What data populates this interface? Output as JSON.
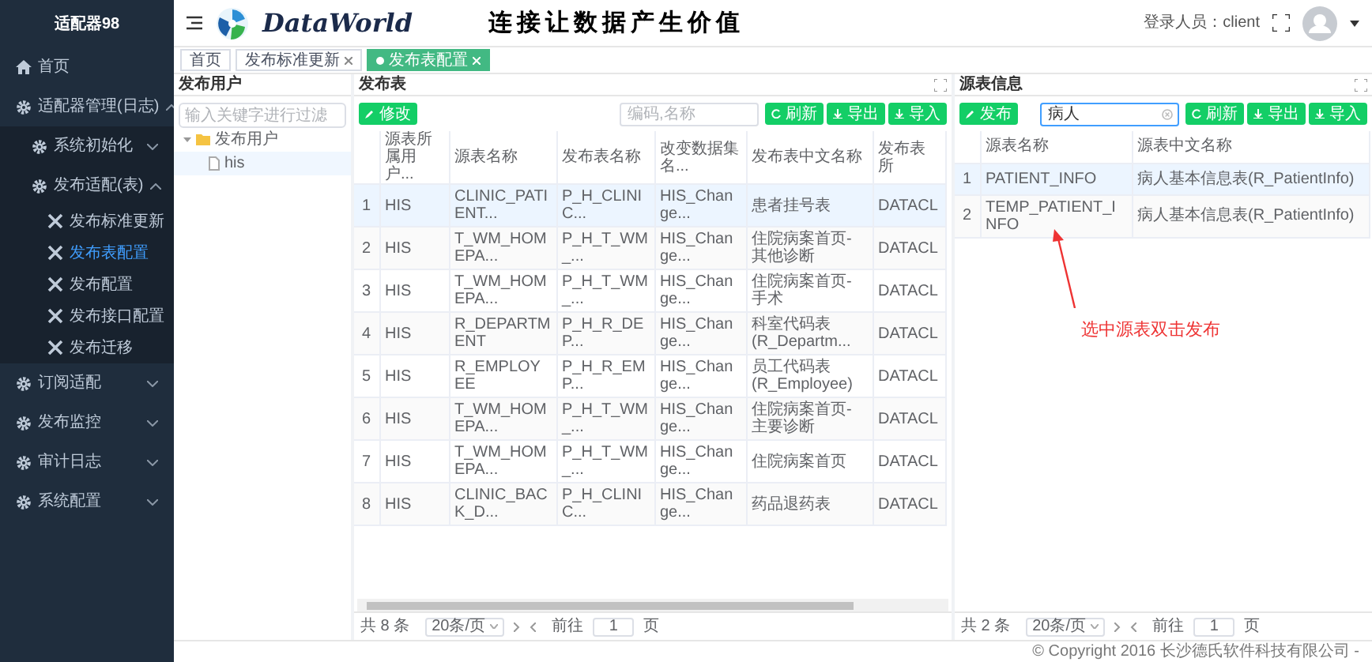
{
  "sidebar": {
    "title": "适配器98",
    "items": [
      {
        "label": "首页",
        "selected": false
      },
      {
        "label": "适配器管理(日志)",
        "expanded": true,
        "selected": false,
        "children": [
          {
            "label": "系统初始化",
            "expanded": false,
            "selected": false
          },
          {
            "label": "发布适配(表)",
            "expanded": true,
            "selected": false,
            "children": [
              {
                "label": "发布标准更新",
                "selected": false
              },
              {
                "label": "发布表配置",
                "selected": true
              },
              {
                "label": "发布配置",
                "selected": false
              },
              {
                "label": "发布接口配置",
                "selected": false
              },
              {
                "label": "发布迁移",
                "selected": false
              }
            ]
          }
        ]
      },
      {
        "label": "订阅适配",
        "expanded": false,
        "selected": false
      },
      {
        "label": "发布监控",
        "expanded": false,
        "selected": false
      },
      {
        "label": "审计日志",
        "expanded": false,
        "selected": false
      },
      {
        "label": "系统配置",
        "expanded": false,
        "selected": false
      }
    ]
  },
  "header": {
    "logo": "DataWorld",
    "slogan": "连接让数据产生价值",
    "user_label": "登录人员：client"
  },
  "tabs": [
    {
      "label": "首页",
      "closable": false,
      "selected": false
    },
    {
      "label": "发布标准更新",
      "closable": true,
      "selected": false
    },
    {
      "label": "发布表配置",
      "closable": true,
      "selected": true
    }
  ],
  "users_panel": {
    "title": "发布用户",
    "search": {
      "placeholder": "输入关键字进行过滤"
    },
    "tree": [
      {
        "label": "发布用户",
        "expanded": true,
        "selected": false,
        "children": [
          {
            "label": "his",
            "selected": true
          }
        ]
      }
    ]
  },
  "publish_panel": {
    "title": "发布表",
    "edit_button": "修改",
    "search": {
      "placeholder": "编码,名称"
    },
    "buttons": [
      "刷新",
      "导出",
      "导入"
    ],
    "columns": [
      "源表所属用户...",
      "源表名称",
      "发布表名称",
      "改变数据集名...",
      "发布表中文名称",
      "发布表所"
    ],
    "rows": [
      {
        "index": "1",
        "cells": [
          "HIS",
          "CLINIC_PATIENT...",
          "P_H_CLINIC...",
          "HIS_Change...",
          "患者挂号表",
          "DATACL"
        ],
        "selected": true
      },
      {
        "index": "2",
        "cells": [
          "HIS",
          "T_WM_HOMEPA...",
          "P_H_T_WM_...",
          "HIS_Change...",
          "住院病案首页-其他诊断",
          "DATACL"
        ],
        "selected": false
      },
      {
        "index": "3",
        "cells": [
          "HIS",
          "T_WM_HOMEPA...",
          "P_H_T_WM_...",
          "HIS_Change...",
          "住院病案首页-手术",
          "DATACL"
        ],
        "selected": false
      },
      {
        "index": "4",
        "cells": [
          "HIS",
          "R_DEPARTMENT",
          "P_H_R_DEP...",
          "HIS_Change...",
          "科室代码表(R_Departm...",
          "DATACL"
        ],
        "selected": false
      },
      {
        "index": "5",
        "cells": [
          "HIS",
          "R_EMPLOYEE",
          "P_H_R_EMP...",
          "HIS_Change...",
          "员工代码表(R_Employee)",
          "DATACL"
        ],
        "selected": false
      },
      {
        "index": "6",
        "cells": [
          "HIS",
          "T_WM_HOMEPA...",
          "P_H_T_WM_...",
          "HIS_Change...",
          "住院病案首页-主要诊断",
          "DATACL"
        ],
        "selected": false
      },
      {
        "index": "7",
        "cells": [
          "HIS",
          "T_WM_HOMEPA...",
          "P_H_T_WM_...",
          "HIS_Change...",
          "住院病案首页",
          "DATACL"
        ],
        "selected": false
      },
      {
        "index": "8",
        "cells": [
          "HIS",
          "CLINIC_BACK_D...",
          "P_H_CLINIC...",
          "HIS_Change...",
          "药品退药表",
          "DATACL"
        ],
        "selected": false
      }
    ],
    "pagination": {
      "total": "共 8 条",
      "page_size": "20条/页",
      "goto": "前往",
      "page": "1",
      "page_unit": "页"
    }
  },
  "source_panel": {
    "title": "源表信息",
    "publish_button": "发布",
    "search": {
      "value": "病人"
    },
    "buttons": [
      "刷新",
      "导出",
      "导入"
    ],
    "columns": [
      "源表名称",
      "源表中文名称"
    ],
    "rows": [
      {
        "index": "1",
        "cells": [
          "PATIENT_INFO",
          "病人基本信息表(R_PatientInfo)"
        ],
        "selected": true
      },
      {
        "index": "2",
        "cells": [
          "TEMP_PATIENT_INFO",
          "病人基本信息表(R_PatientInfo)"
        ],
        "selected": false
      }
    ],
    "annotation": "选中源表双击发布",
    "pagination": {
      "total": "共 2 条",
      "page_size": "20条/页",
      "goto": "前往",
      "page": "1",
      "page_unit": "页"
    }
  },
  "footer": "© Copyright 2016 长沙德氏软件科技有限公司 -"
}
